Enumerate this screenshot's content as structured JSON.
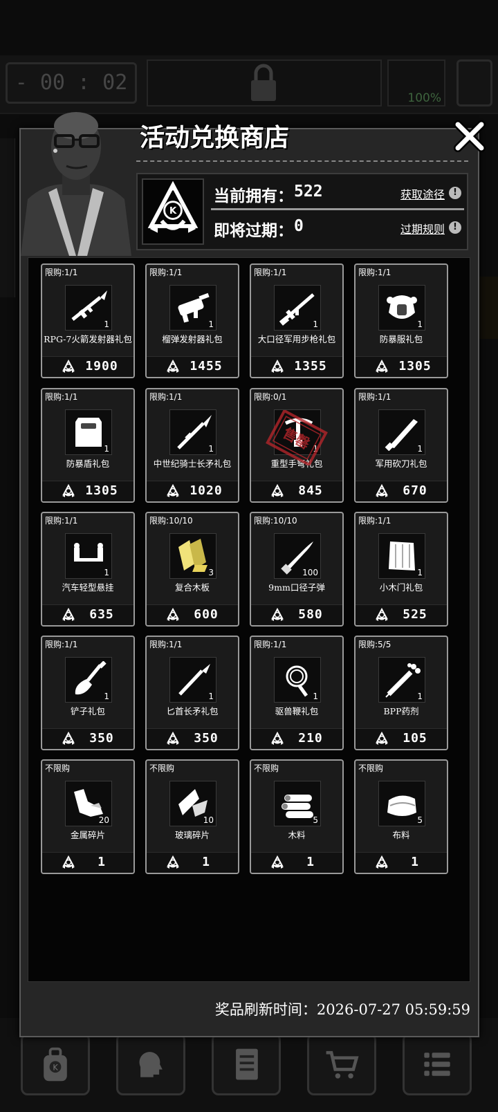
{
  "hud": {
    "timer": "- 00 : 02 -",
    "battery": "100%"
  },
  "modal": {
    "title": "活动兑换商店",
    "owned_label": "当前拥有：",
    "owned_value": "522",
    "expiring_label": "即将过期：",
    "expiring_value": "0",
    "get_link": "获取途径",
    "rule_link": "过期规则",
    "refresh_label": "奖品刷新时间：",
    "refresh_time": "2026-07-27 05:59:59",
    "sold_out_stamp": "售罄"
  },
  "items": [
    {
      "limit": "限购:1/1",
      "name": "RPG-7火箭发射器礼包",
      "qty": "1",
      "price": "1900",
      "icon": "rpg-icon"
    },
    {
      "limit": "限购:1/1",
      "name": "榴弹发射器礼包",
      "qty": "1",
      "price": "1455",
      "icon": "grenade-launcher-icon"
    },
    {
      "limit": "限购:1/1",
      "name": "大口径军用步枪礼包",
      "qty": "1",
      "price": "1355",
      "icon": "rifle-icon"
    },
    {
      "limit": "限购:1/1",
      "name": "防暴服礼包",
      "qty": "1",
      "price": "1305",
      "icon": "riot-suit-icon"
    },
    {
      "limit": "限购:1/1",
      "name": "防暴盾礼包",
      "qty": "1",
      "price": "1305",
      "icon": "riot-shield-icon"
    },
    {
      "limit": "限购:1/1",
      "name": "中世纪骑士长矛礼包",
      "qty": "1",
      "price": "1020",
      "icon": "spear-icon"
    },
    {
      "limit": "限购:0/1",
      "name": "重型手弩礼包",
      "qty": "1",
      "price": "845",
      "icon": "crossbow-icon",
      "sold_out": true
    },
    {
      "limit": "限购:1/1",
      "name": "军用砍刀礼包",
      "qty": "1",
      "price": "670",
      "icon": "machete-icon"
    },
    {
      "limit": "限购:1/1",
      "name": "汽车轻型悬挂",
      "qty": "1",
      "price": "635",
      "icon": "suspension-icon"
    },
    {
      "limit": "限购:10/10",
      "name": "复合木板",
      "qty": "3",
      "price": "600",
      "icon": "plywood-icon"
    },
    {
      "limit": "限购:10/10",
      "name": "9mm口径子弹",
      "qty": "100",
      "price": "580",
      "icon": "bullet-icon"
    },
    {
      "limit": "限购:1/1",
      "name": "小木门礼包",
      "qty": "1",
      "price": "525",
      "icon": "wood-door-icon"
    },
    {
      "limit": "限购:1/1",
      "name": "铲子礼包",
      "qty": "1",
      "price": "350",
      "icon": "shovel-icon"
    },
    {
      "limit": "限购:1/1",
      "name": "匕首长矛礼包",
      "qty": "1",
      "price": "350",
      "icon": "dagger-spear-icon"
    },
    {
      "limit": "限购:1/1",
      "name": "驱兽鞭礼包",
      "qty": "1",
      "price": "210",
      "icon": "whip-icon"
    },
    {
      "limit": "限购:5/5",
      "name": "BPP药剂",
      "qty": "1",
      "price": "105",
      "icon": "syringe-icon"
    },
    {
      "limit": "不限购",
      "name": "金属碎片",
      "qty": "20",
      "price": "1",
      "icon": "metal-scrap-icon"
    },
    {
      "limit": "不限购",
      "name": "玻璃碎片",
      "qty": "10",
      "price": "1",
      "icon": "glass-shard-icon"
    },
    {
      "limit": "不限购",
      "name": "木料",
      "qty": "5",
      "price": "1",
      "icon": "wood-log-icon"
    },
    {
      "limit": "不限购",
      "name": "布料",
      "qty": "5",
      "price": "1",
      "icon": "cloth-icon"
    }
  ],
  "nav": [
    "backpack-icon",
    "brain-icon",
    "journal-icon",
    "shop-cart-icon",
    "menu-list-icon"
  ]
}
